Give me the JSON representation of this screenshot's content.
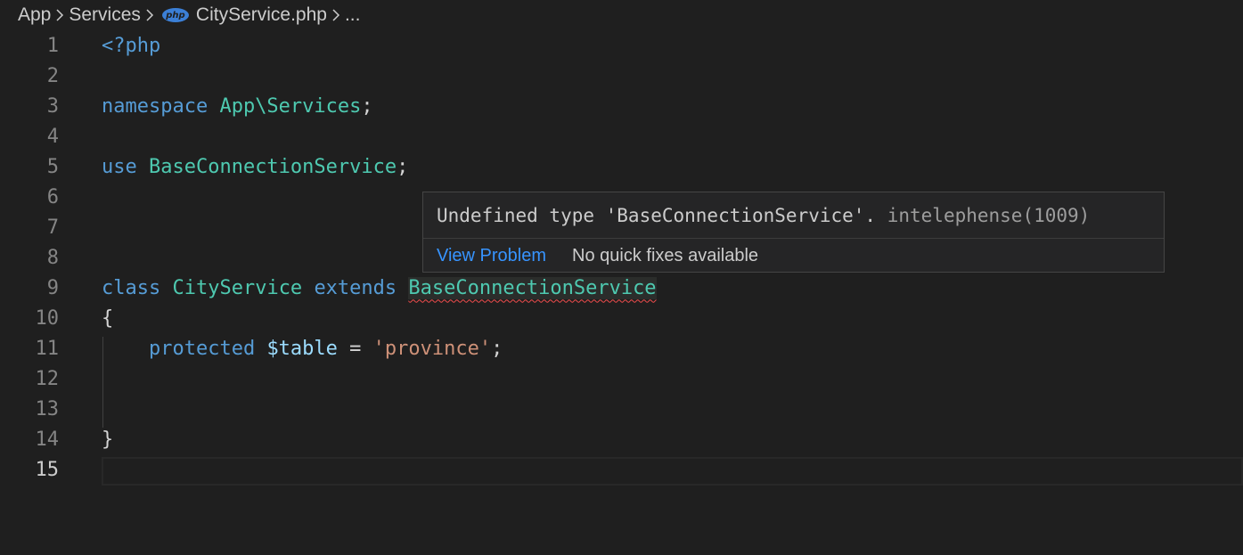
{
  "breadcrumb": {
    "items": [
      "App",
      "Services",
      "CityService.php",
      "..."
    ],
    "file_icon": "php-icon",
    "file_icon_text": "php"
  },
  "editor": {
    "lines": [
      {
        "number": "1",
        "tokens": [
          {
            "t": "<?php",
            "c": "kw"
          }
        ]
      },
      {
        "number": "2",
        "tokens": []
      },
      {
        "number": "3",
        "tokens": [
          {
            "t": "namespace ",
            "c": "kw"
          },
          {
            "t": "App\\Services",
            "c": "ty"
          },
          {
            "t": ";",
            "c": "pl"
          }
        ]
      },
      {
        "number": "4",
        "tokens": []
      },
      {
        "number": "5",
        "tokens": [
          {
            "t": "use ",
            "c": "kw"
          },
          {
            "t": "BaseConnectionService",
            "c": "ty"
          },
          {
            "t": ";",
            "c": "pl"
          }
        ]
      },
      {
        "number": "6",
        "tokens": []
      },
      {
        "number": "7",
        "tokens": []
      },
      {
        "number": "8",
        "tokens": []
      },
      {
        "number": "9",
        "tokens": [
          {
            "t": "class ",
            "c": "kw"
          },
          {
            "t": "CityService ",
            "c": "ty"
          },
          {
            "t": "extends ",
            "c": "kw"
          },
          {
            "t": "BaseConnectionService",
            "c": "ty squiggle"
          }
        ]
      },
      {
        "number": "10",
        "tokens": [
          {
            "t": "{",
            "c": "pl"
          }
        ]
      },
      {
        "number": "11",
        "tokens": [
          {
            "t": "    ",
            "c": "pl"
          },
          {
            "t": "protected ",
            "c": "kw"
          },
          {
            "t": "$table",
            "c": "vr"
          },
          {
            "t": " = ",
            "c": "pl"
          },
          {
            "t": "'province'",
            "c": "st"
          },
          {
            "t": ";",
            "c": "pl"
          }
        ]
      },
      {
        "number": "12",
        "tokens": []
      },
      {
        "number": "13",
        "tokens": []
      },
      {
        "number": "14",
        "tokens": [
          {
            "t": "}",
            "c": "pl"
          }
        ]
      },
      {
        "number": "15",
        "tokens": [],
        "active": true
      }
    ]
  },
  "hover": {
    "message": "Undefined type 'BaseConnectionService'. ",
    "source": "intelephense(1009)",
    "view_problem_label": "View Problem",
    "no_fix_label": "No quick fixes available"
  },
  "colors": {
    "background": "#1f1f1f",
    "keyword": "#569cd6",
    "type": "#4ec9b0",
    "string": "#ce9178",
    "variable": "#9cdcfe",
    "error": "#f14c4c",
    "link": "#3794ff"
  }
}
